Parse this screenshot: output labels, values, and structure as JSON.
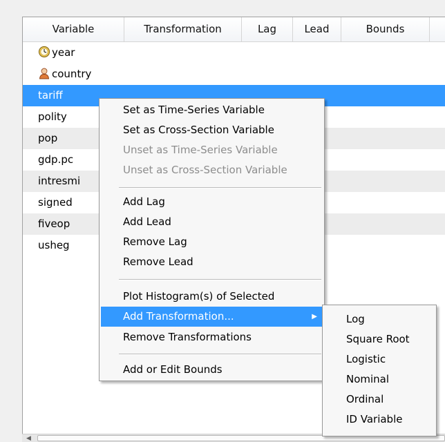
{
  "table": {
    "columns": [
      "Variable",
      "Transformation",
      "Lag",
      "Lead",
      "Bounds"
    ],
    "rows": [
      {
        "name": "year",
        "icon": "clock-icon"
      },
      {
        "name": "country",
        "icon": "person-icon"
      },
      {
        "name": "tariff"
      },
      {
        "name": "polity"
      },
      {
        "name": "pop"
      },
      {
        "name": "gdp.pc"
      },
      {
        "name": "intresmi"
      },
      {
        "name": "signed"
      },
      {
        "name": "fiveop"
      },
      {
        "name": "usheg"
      }
    ],
    "selected_row": "tariff"
  },
  "context_menu": {
    "items": [
      {
        "label": "Set as Time-Series Variable",
        "enabled": true
      },
      {
        "label": "Set as Cross-Section Variable",
        "enabled": true
      },
      {
        "label": "Unset as Time-Series Variable",
        "enabled": false
      },
      {
        "label": "Unset as Cross-Section Variable",
        "enabled": false
      },
      {
        "label": "Add Lag",
        "enabled": true
      },
      {
        "label": "Add Lead",
        "enabled": true
      },
      {
        "label": "Remove Lag",
        "enabled": true
      },
      {
        "label": "Remove Lead",
        "enabled": true
      },
      {
        "label": "Plot Histogram(s) of Selected",
        "enabled": true
      },
      {
        "label": "Add Transformation...",
        "enabled": true,
        "highlighted": true,
        "submenu": true
      },
      {
        "label": "Remove Transformations",
        "enabled": true
      },
      {
        "label": "Add or Edit Bounds",
        "enabled": true
      }
    ]
  },
  "submenu": {
    "items": [
      "Log",
      "Square Root",
      "Logistic",
      "Nominal",
      "Ordinal",
      "ID Variable"
    ]
  },
  "colors": {
    "selection": "#3399ff",
    "alt_row": "#ececec"
  }
}
